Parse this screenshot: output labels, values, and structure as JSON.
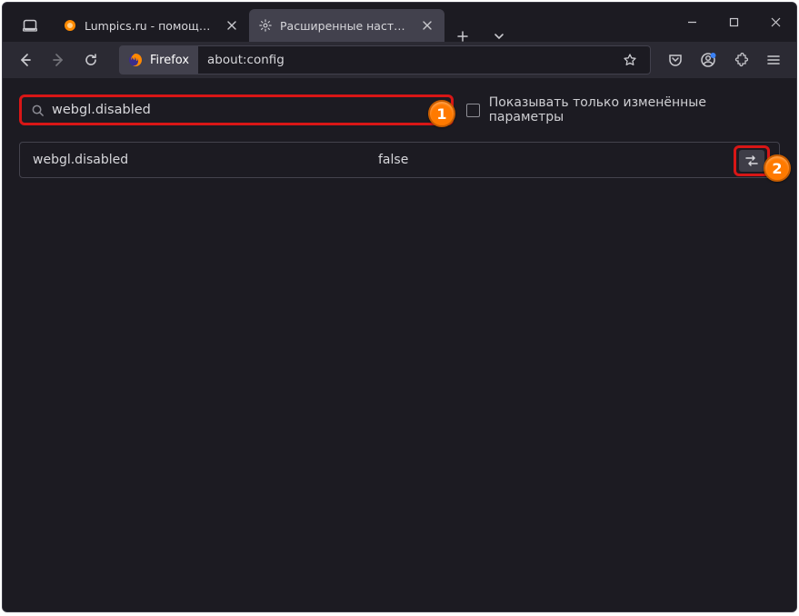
{
  "tabs": [
    {
      "title": "Lumpics.ru - помощь с компь",
      "active": false
    },
    {
      "title": "Расширенные настройки",
      "active": true
    }
  ],
  "urlbar": {
    "identity_label": "Firefox",
    "url": "about:config"
  },
  "config": {
    "search_value": "webgl.disabled",
    "filter_label": "Показывать только изменённые параметры",
    "result": {
      "name": "webgl.disabled",
      "value": "false"
    }
  },
  "annotations": {
    "badge1": "1",
    "badge2": "2"
  }
}
